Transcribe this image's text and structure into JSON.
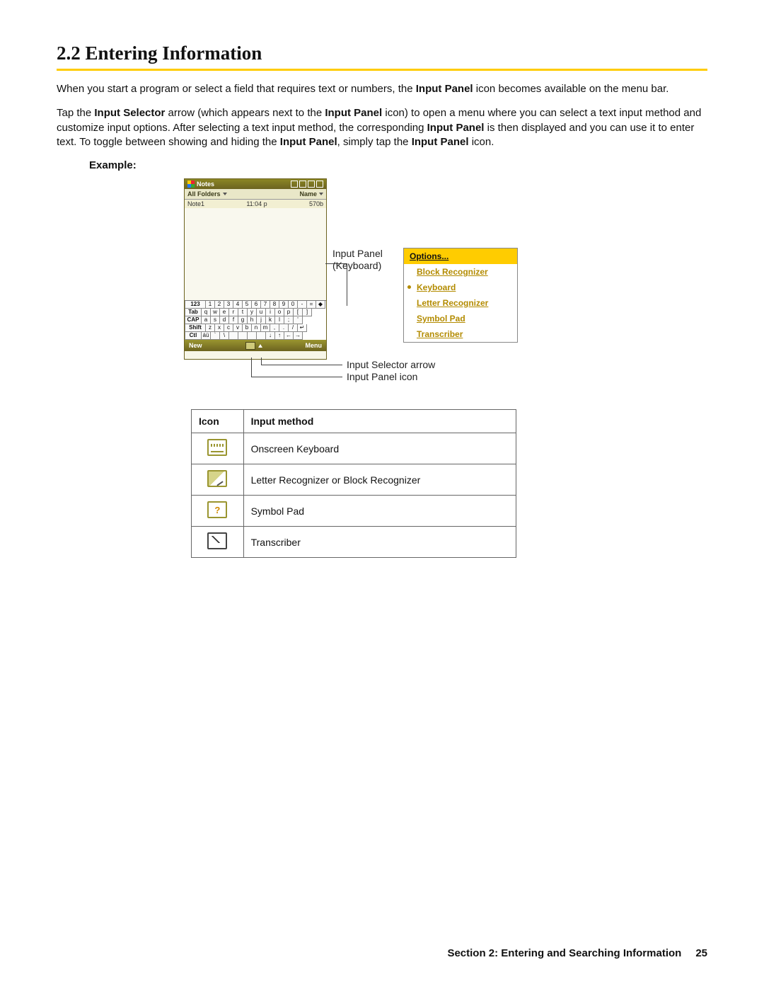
{
  "heading": "2.2  Entering Information",
  "para1_parts": [
    "When you start a program or select a field that requires text or numbers, the ",
    "Input Panel",
    " icon becomes available on the menu bar."
  ],
  "para2_parts": [
    "Tap the ",
    "Input Selector",
    " arrow (which appears next to the ",
    "Input Panel",
    " icon) to open a menu where you can select a text input method and customize input options. After selecting a text input method, the corresponding ",
    "Input Panel",
    " is then displayed and you can use it to enter text. To toggle between showing and hiding the ",
    "Input Panel",
    ", simply tap the ",
    "Input Panel",
    " icon."
  ],
  "example_label": "Example:",
  "device": {
    "app_title": "Notes",
    "subbar_left": "All Folders",
    "subbar_right": "Name",
    "row_name": "Note1",
    "row_time": "11:04 p",
    "row_size": "570b",
    "bottom_left": "New",
    "bottom_right": "Menu",
    "kbd_rows": [
      [
        "123",
        "1",
        "2",
        "3",
        "4",
        "5",
        "6",
        "7",
        "8",
        "9",
        "0",
        "-",
        "=",
        "◆"
      ],
      [
        "Tab",
        "q",
        "w",
        "e",
        "r",
        "t",
        "y",
        "u",
        "i",
        "o",
        "p",
        "[",
        "]"
      ],
      [
        "CAP",
        "a",
        "s",
        "d",
        "f",
        "g",
        "h",
        "j",
        "k",
        "l",
        ";",
        "'"
      ],
      [
        "Shift",
        "z",
        "x",
        "c",
        "v",
        "b",
        "n",
        "m",
        ",",
        ".",
        "/",
        "↵"
      ],
      [
        "Ctl",
        "áü",
        "`",
        "\\",
        " ",
        " ",
        " ",
        " ",
        "↓",
        "↑",
        "←",
        "→"
      ]
    ]
  },
  "callouts": {
    "panel_kb_l1": "Input Panel",
    "panel_kb_l2": "(Keyboard)",
    "selector_arrow": "Input Selector arrow",
    "panel_icon": "Input Panel icon"
  },
  "popup": {
    "head": "Options...",
    "items": [
      "Block Recognizer",
      "Keyboard",
      "Letter Recognizer",
      "Symbol Pad",
      "Transcriber"
    ],
    "selected_index": 1
  },
  "table": {
    "h_icon": "Icon",
    "h_method": "Input method",
    "rows": [
      {
        "icon": "kb",
        "label": "Onscreen Keyboard"
      },
      {
        "icon": "pen",
        "label": "Letter Recognizer or Block Recognizer"
      },
      {
        "icon": "sym",
        "label": "Symbol Pad"
      },
      {
        "icon": "tr",
        "label": "Transcriber"
      }
    ]
  },
  "footer": {
    "section": "Section 2: Entering and Searching Information",
    "page": "25"
  }
}
